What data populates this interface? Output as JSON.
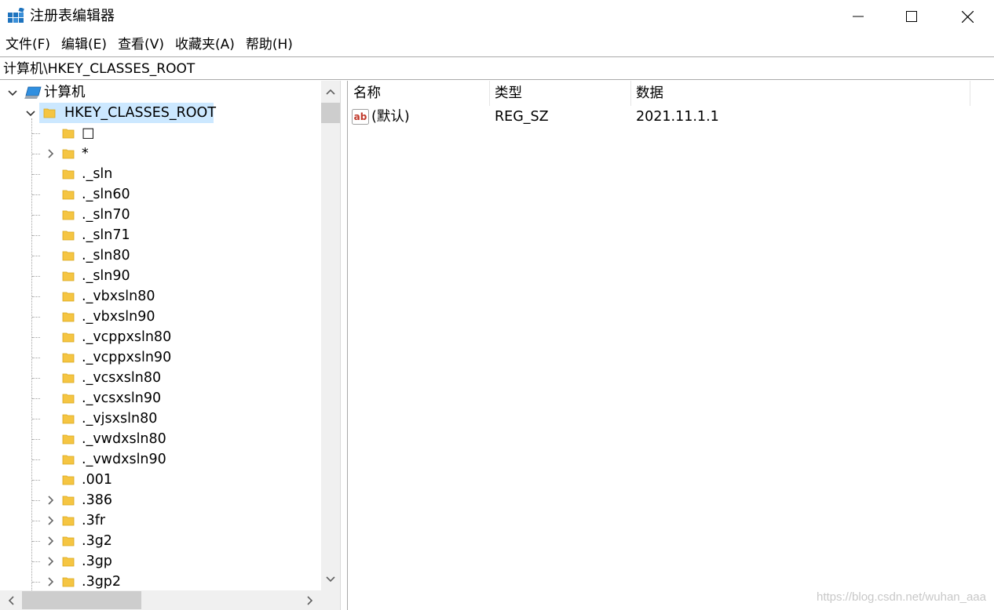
{
  "window": {
    "title": "注册表编辑器",
    "icons": {
      "app": "registry-editor-icon",
      "minimize": "minimize-icon",
      "maximize": "maximize-icon",
      "close": "close-icon"
    }
  },
  "menu": {
    "items": [
      {
        "label": "文件(F)"
      },
      {
        "label": "编辑(E)"
      },
      {
        "label": "查看(V)"
      },
      {
        "label": "收藏夹(A)"
      },
      {
        "label": "帮助(H)"
      }
    ]
  },
  "address": {
    "path": "计算机\\HKEY_CLASSES_ROOT"
  },
  "tree": {
    "root": {
      "label": "计算机",
      "icon": "computer-icon",
      "expanded": true
    },
    "selected": {
      "label": "HKEY_CLASSES_ROOT",
      "icon": "folder-icon",
      "expanded": true
    },
    "children": [
      {
        "label": "□",
        "expandable": false
      },
      {
        "label": "*",
        "expandable": true
      },
      {
        "label": "._sln",
        "expandable": false
      },
      {
        "label": "._sln60",
        "expandable": false
      },
      {
        "label": "._sln70",
        "expandable": false
      },
      {
        "label": "._sln71",
        "expandable": false
      },
      {
        "label": "._sln80",
        "expandable": false
      },
      {
        "label": "._sln90",
        "expandable": false
      },
      {
        "label": "._vbxsln80",
        "expandable": false
      },
      {
        "label": "._vbxsln90",
        "expandable": false
      },
      {
        "label": "._vcppxsln80",
        "expandable": false
      },
      {
        "label": "._vcppxsln90",
        "expandable": false
      },
      {
        "label": "._vcsxsln80",
        "expandable": false
      },
      {
        "label": "._vcsxsln90",
        "expandable": false
      },
      {
        "label": "._vjsxsln80",
        "expandable": false
      },
      {
        "label": "._vwdxsln80",
        "expandable": false
      },
      {
        "label": "._vwdxsln90",
        "expandable": false
      },
      {
        "label": ".001",
        "expandable": false
      },
      {
        "label": ".386",
        "expandable": true
      },
      {
        "label": ".3fr",
        "expandable": true
      },
      {
        "label": ".3g2",
        "expandable": true
      },
      {
        "label": ".3gp",
        "expandable": true
      },
      {
        "label": ".3gp2",
        "expandable": true
      }
    ]
  },
  "list": {
    "columns": {
      "name": "名称",
      "type": "类型",
      "data": "数据"
    },
    "rows": [
      {
        "name": "(默认)",
        "type": "REG_SZ",
        "data": "2021.11.1.1",
        "icon": "string-value-icon"
      }
    ]
  },
  "watermark": "https://blog.csdn.net/wuhan_aaa",
  "colors": {
    "selection": "#cce8ff",
    "folder": "#f5c542",
    "scrollbar_track": "#f0f0f0",
    "scrollbar_thumb": "#cdcdcd"
  }
}
